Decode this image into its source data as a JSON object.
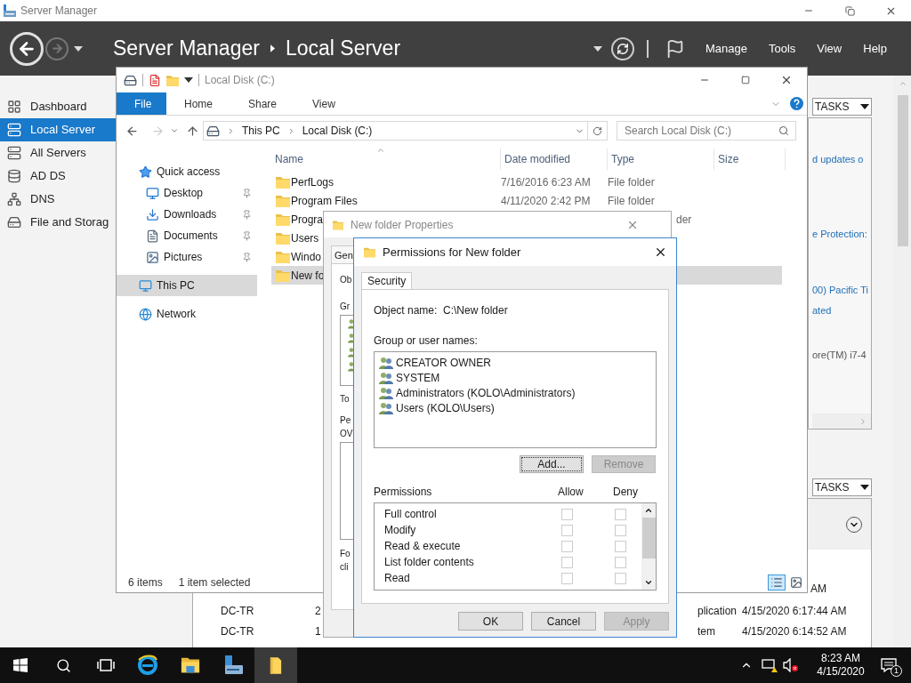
{
  "server_manager": {
    "title": "Server Manager",
    "breadcrumb": [
      "Server Manager",
      "Local Server"
    ],
    "menu": [
      "Manage",
      "Tools",
      "View",
      "Help"
    ],
    "nav": [
      {
        "label": "Dashboard",
        "selected": false,
        "kind": "grid"
      },
      {
        "label": "Local Server",
        "selected": true,
        "kind": "server"
      },
      {
        "label": "All Servers",
        "selected": false,
        "kind": "servers"
      },
      {
        "label": "AD DS",
        "selected": false,
        "kind": "directory"
      },
      {
        "label": "DNS",
        "selected": false,
        "kind": "dns"
      },
      {
        "label": "File and Storag",
        "selected": false,
        "kind": "storage"
      }
    ],
    "properties_panel": {
      "tasks": "TASKS",
      "links": [
        "d updates o",
        "e Protection:",
        "00) Pacific Ti",
        "ated"
      ],
      "text": "ore(TM) i7-4"
    },
    "events_panel": {
      "tasks": "TASKS",
      "partial_row": "AM",
      "rows": [
        [
          "DC-TR",
          "2",
          "plication",
          "4/15/2020 6:17:44 AM"
        ],
        [
          "DC-TR",
          "1",
          "tem",
          "4/15/2020 6:14:52 AM"
        ]
      ]
    }
  },
  "explorer": {
    "title": "Local Disk (C:)",
    "ribbon_tabs": [
      {
        "label": "File",
        "selected": true
      },
      {
        "label": "Home",
        "selected": false
      },
      {
        "label": "Share",
        "selected": false
      },
      {
        "label": "View",
        "selected": false
      }
    ],
    "address": [
      "This PC",
      "Local Disk (C:)"
    ],
    "search": {
      "placeholder": "Search Local Disk (C:)"
    },
    "nav": [
      {
        "label": "Quick access",
        "kind": "star",
        "selected": false,
        "children": [
          {
            "label": "Desktop",
            "kind": "desktop",
            "pinned": true
          },
          {
            "label": "Downloads",
            "kind": "download",
            "pinned": true
          },
          {
            "label": "Documents",
            "kind": "document",
            "pinned": true
          },
          {
            "label": "Pictures",
            "kind": "picture",
            "pinned": true
          }
        ]
      },
      {
        "label": "This PC",
        "kind": "pc",
        "selected": true
      },
      {
        "label": "Network",
        "kind": "network",
        "selected": false
      }
    ],
    "columns": [
      "Name",
      "Date modified",
      "Type",
      "Size"
    ],
    "rows": [
      {
        "name": "PerfLogs",
        "date": "7/16/2016 6:23 AM",
        "type": "File folder",
        "selected": false
      },
      {
        "name": "Program Files",
        "date": "4/11/2020 2:42 PM",
        "type": "File folder",
        "selected": false
      },
      {
        "name": "Progra",
        "type": "der",
        "selected": false
      },
      {
        "name": "Users",
        "selected": false
      },
      {
        "name": "Windo",
        "selected": false
      },
      {
        "name": "New fo",
        "selected": true
      }
    ],
    "status": [
      "6 items",
      "1 item selected"
    ],
    "views": [
      {
        "kind": "details",
        "selected": true
      },
      {
        "kind": "large_icons",
        "selected": false
      }
    ]
  },
  "properties_dialog": {
    "title": "New folder Properties",
    "tab": "Gen",
    "fragments": [
      "Ob",
      "Gr",
      "To",
      "Pe",
      "OV",
      "Fo",
      "cli"
    ]
  },
  "permissions_dialog": {
    "title": "Permissions for New folder",
    "tabs": [
      {
        "label": "Security",
        "selected": true
      }
    ],
    "object_label": "Object name:",
    "object_value": "C:\\New folder",
    "group_label": "Group or user names:",
    "users": [
      "CREATOR OWNER",
      "SYSTEM",
      "Administrators (KOLO\\Administrators)",
      "Users (KOLO\\Users)"
    ],
    "user_buttons": [
      {
        "label": "Add...",
        "disabled": false,
        "focused": true
      },
      {
        "label": "Remove",
        "disabled": true,
        "focused": false
      }
    ],
    "permissions_label": "Permissions",
    "allow_label": "Allow",
    "deny_label": "Deny",
    "permissions": [
      {
        "name": "Full control",
        "allow": false,
        "deny": false
      },
      {
        "name": "Modify",
        "allow": false,
        "deny": false
      },
      {
        "name": "Read & execute",
        "allow": false,
        "deny": false
      },
      {
        "name": "List folder contents",
        "allow": false,
        "deny": false
      },
      {
        "name": "Read",
        "allow": false,
        "deny": false
      }
    ],
    "buttons": [
      {
        "label": "OK",
        "disabled": false
      },
      {
        "label": "Cancel",
        "disabled": false
      },
      {
        "label": "Apply",
        "disabled": true
      }
    ]
  },
  "taskbar": {
    "apps": [
      {
        "kind": "browser",
        "active": false
      },
      {
        "kind": "explorer",
        "active": false
      },
      {
        "kind": "server_manager",
        "active": false
      },
      {
        "kind": "folder",
        "active": true
      }
    ],
    "time": "8:23 AM",
    "date": "4/15/2020",
    "notifications": "1"
  }
}
